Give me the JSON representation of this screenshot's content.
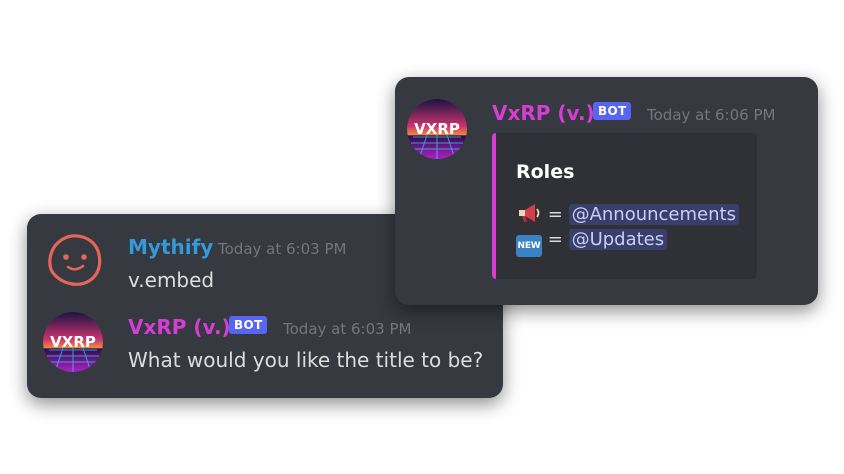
{
  "colors": {
    "card_bg": "#36393f",
    "embed_bg": "#2f3136",
    "mythify_name": "#3498db",
    "bot_name": "#d53ed4",
    "bot_badge": "#5865f2",
    "embed_accent": "#d53ed4",
    "timestamp": "#72767d",
    "message_text": "#dcddde",
    "mention_text": "#c9cdfb"
  },
  "chat": {
    "messages": [
      {
        "author": "Mythify",
        "timestamp": "Today at 6:03 PM",
        "text": "v.embed",
        "avatar_icon": "ghost-blob-avatar-icon"
      },
      {
        "author": "VxRP (v.)",
        "badge": "BOT",
        "timestamp": "Today at 6:03 PM",
        "text": "What would you like the title to be?",
        "avatar_icon": "vxrp-logo-avatar-icon"
      }
    ]
  },
  "embed_message": {
    "author": "VxRP (v.)",
    "badge": "BOT",
    "timestamp": "Today at 6:06 PM",
    "avatar_icon": "vxrp-logo-avatar-icon",
    "embed": {
      "title": "Roles",
      "roles": [
        {
          "emoji": "megaphone-emoji",
          "separator": "=",
          "mention": "@Announcements"
        },
        {
          "emoji": "new-button-emoji",
          "emoji_text": "NEW",
          "separator": "=",
          "mention": "@Updates"
        }
      ]
    }
  },
  "avatar_logo_text": "VXRP"
}
